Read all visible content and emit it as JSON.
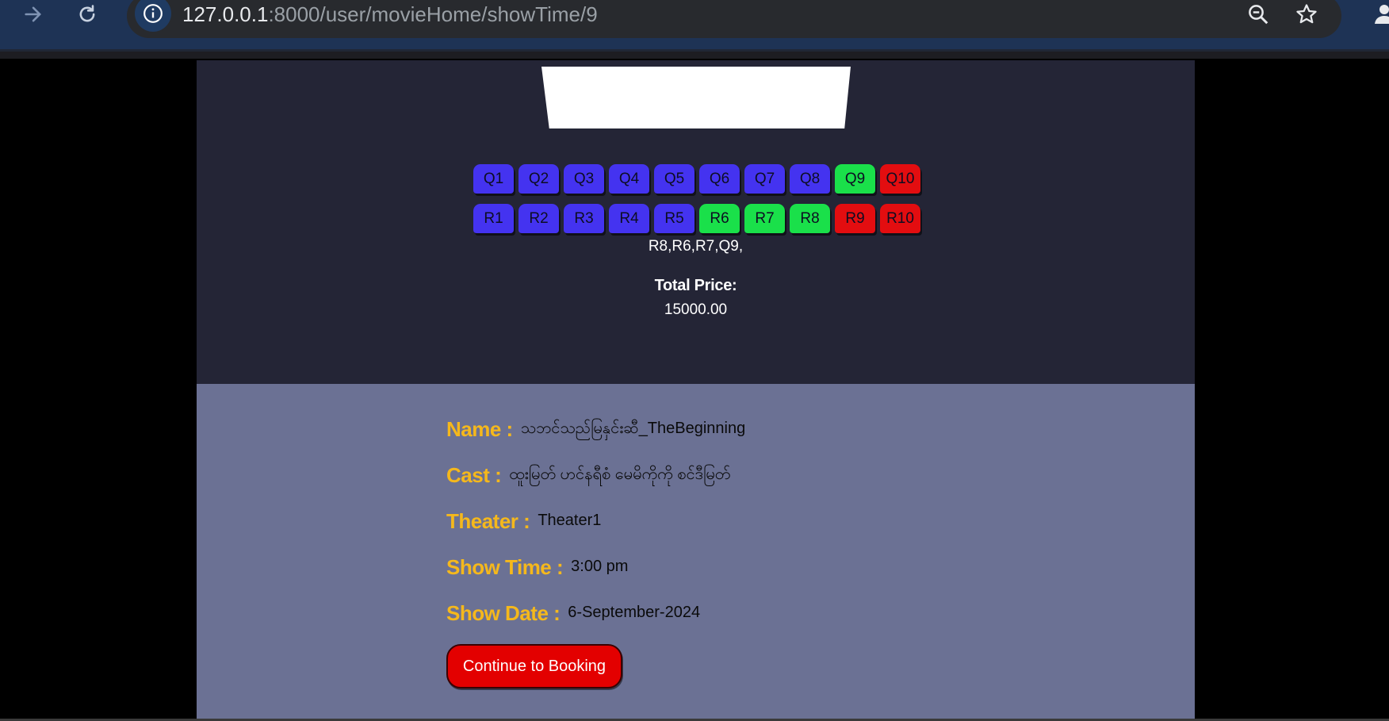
{
  "browser": {
    "url_host": "127.0.0.1",
    "url_rest": ":8000/user/movieHome/showTime/9",
    "icons": [
      "arrow-forward-icon",
      "reload-icon",
      "info-icon",
      "zoom-out-icon",
      "star-icon",
      "profile-icon"
    ]
  },
  "seats": {
    "rows": [
      [
        {
          "label": "Q1",
          "status": "available"
        },
        {
          "label": "Q2",
          "status": "available"
        },
        {
          "label": "Q3",
          "status": "available"
        },
        {
          "label": "Q4",
          "status": "available"
        },
        {
          "label": "Q5",
          "status": "available"
        },
        {
          "label": "Q6",
          "status": "available"
        },
        {
          "label": "Q7",
          "status": "available"
        },
        {
          "label": "Q8",
          "status": "available"
        },
        {
          "label": "Q9",
          "status": "selected"
        },
        {
          "label": "Q10",
          "status": "booked"
        }
      ],
      [
        {
          "label": "R1",
          "status": "available"
        },
        {
          "label": "R2",
          "status": "available"
        },
        {
          "label": "R3",
          "status": "available"
        },
        {
          "label": "R4",
          "status": "available"
        },
        {
          "label": "R5",
          "status": "available"
        },
        {
          "label": "R6",
          "status": "selected"
        },
        {
          "label": "R7",
          "status": "selected"
        },
        {
          "label": "R8",
          "status": "selected"
        },
        {
          "label": "R9",
          "status": "booked"
        },
        {
          "label": "R10",
          "status": "booked"
        }
      ]
    ],
    "colors": {
      "available": "#4433f0",
      "selected": "#1ae04a",
      "booked": "#e30d10"
    }
  },
  "selected_seats_text": "R8,R6,R7,Q9,",
  "total": {
    "label": "Total Price:",
    "value": "15000.00"
  },
  "movie": {
    "name_label": "Name :",
    "name_value": "သဘင်သည်မြနှင်းဆီ_TheBeginning",
    "cast_label": "Cast :",
    "cast_value": "ထူးမြတ် ဟင်နရီစံ မေမိကိုကို စင်ဒီမြတ်",
    "theater_label": "Theater :",
    "theater_value": "Theater1",
    "time_label": "Show Time :",
    "time_value": "3:00 pm",
    "date_label": "Show Date :",
    "date_value": "6-September-2024"
  },
  "booking_button_label": "Continue to Booking",
  "accent_colors": {
    "label": "#f5b81c",
    "button": "#e30000",
    "info_bg": "#6b7194",
    "seat_bg": "#242536"
  }
}
